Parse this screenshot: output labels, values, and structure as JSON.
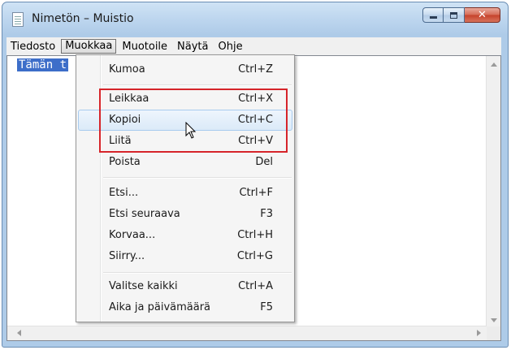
{
  "window": {
    "title": "Nimetön – Muistio"
  },
  "menubar": {
    "items": [
      "Tiedosto",
      "Muokkaa",
      "Muotoile",
      "Näytä",
      "Ohje"
    ]
  },
  "editor": {
    "selected_text": "Tämän t"
  },
  "edit_menu": {
    "items": [
      {
        "label": "Kumoa",
        "shortcut": "Ctrl+Z"
      },
      {
        "label": "Leikkaa",
        "shortcut": "Ctrl+X"
      },
      {
        "label": "Kopioi",
        "shortcut": "Ctrl+C"
      },
      {
        "label": "Liitä",
        "shortcut": "Ctrl+V"
      },
      {
        "label": "Poista",
        "shortcut": "Del"
      },
      {
        "label": "Etsi...",
        "shortcut": "Ctrl+F"
      },
      {
        "label": "Etsi seuraava",
        "shortcut": "F3"
      },
      {
        "label": "Korvaa...",
        "shortcut": "Ctrl+H"
      },
      {
        "label": "Siirry...",
        "shortcut": "Ctrl+G"
      },
      {
        "label": "Valitse kaikki",
        "shortcut": "Ctrl+A"
      },
      {
        "label": "Aika ja päivämäärä",
        "shortcut": "F5"
      }
    ],
    "hovered_item": "Kopioi"
  },
  "colors": {
    "highlight_box": "#d6242a",
    "selection": "#3d6ec9",
    "menu_hover": "#dbeaf8"
  }
}
